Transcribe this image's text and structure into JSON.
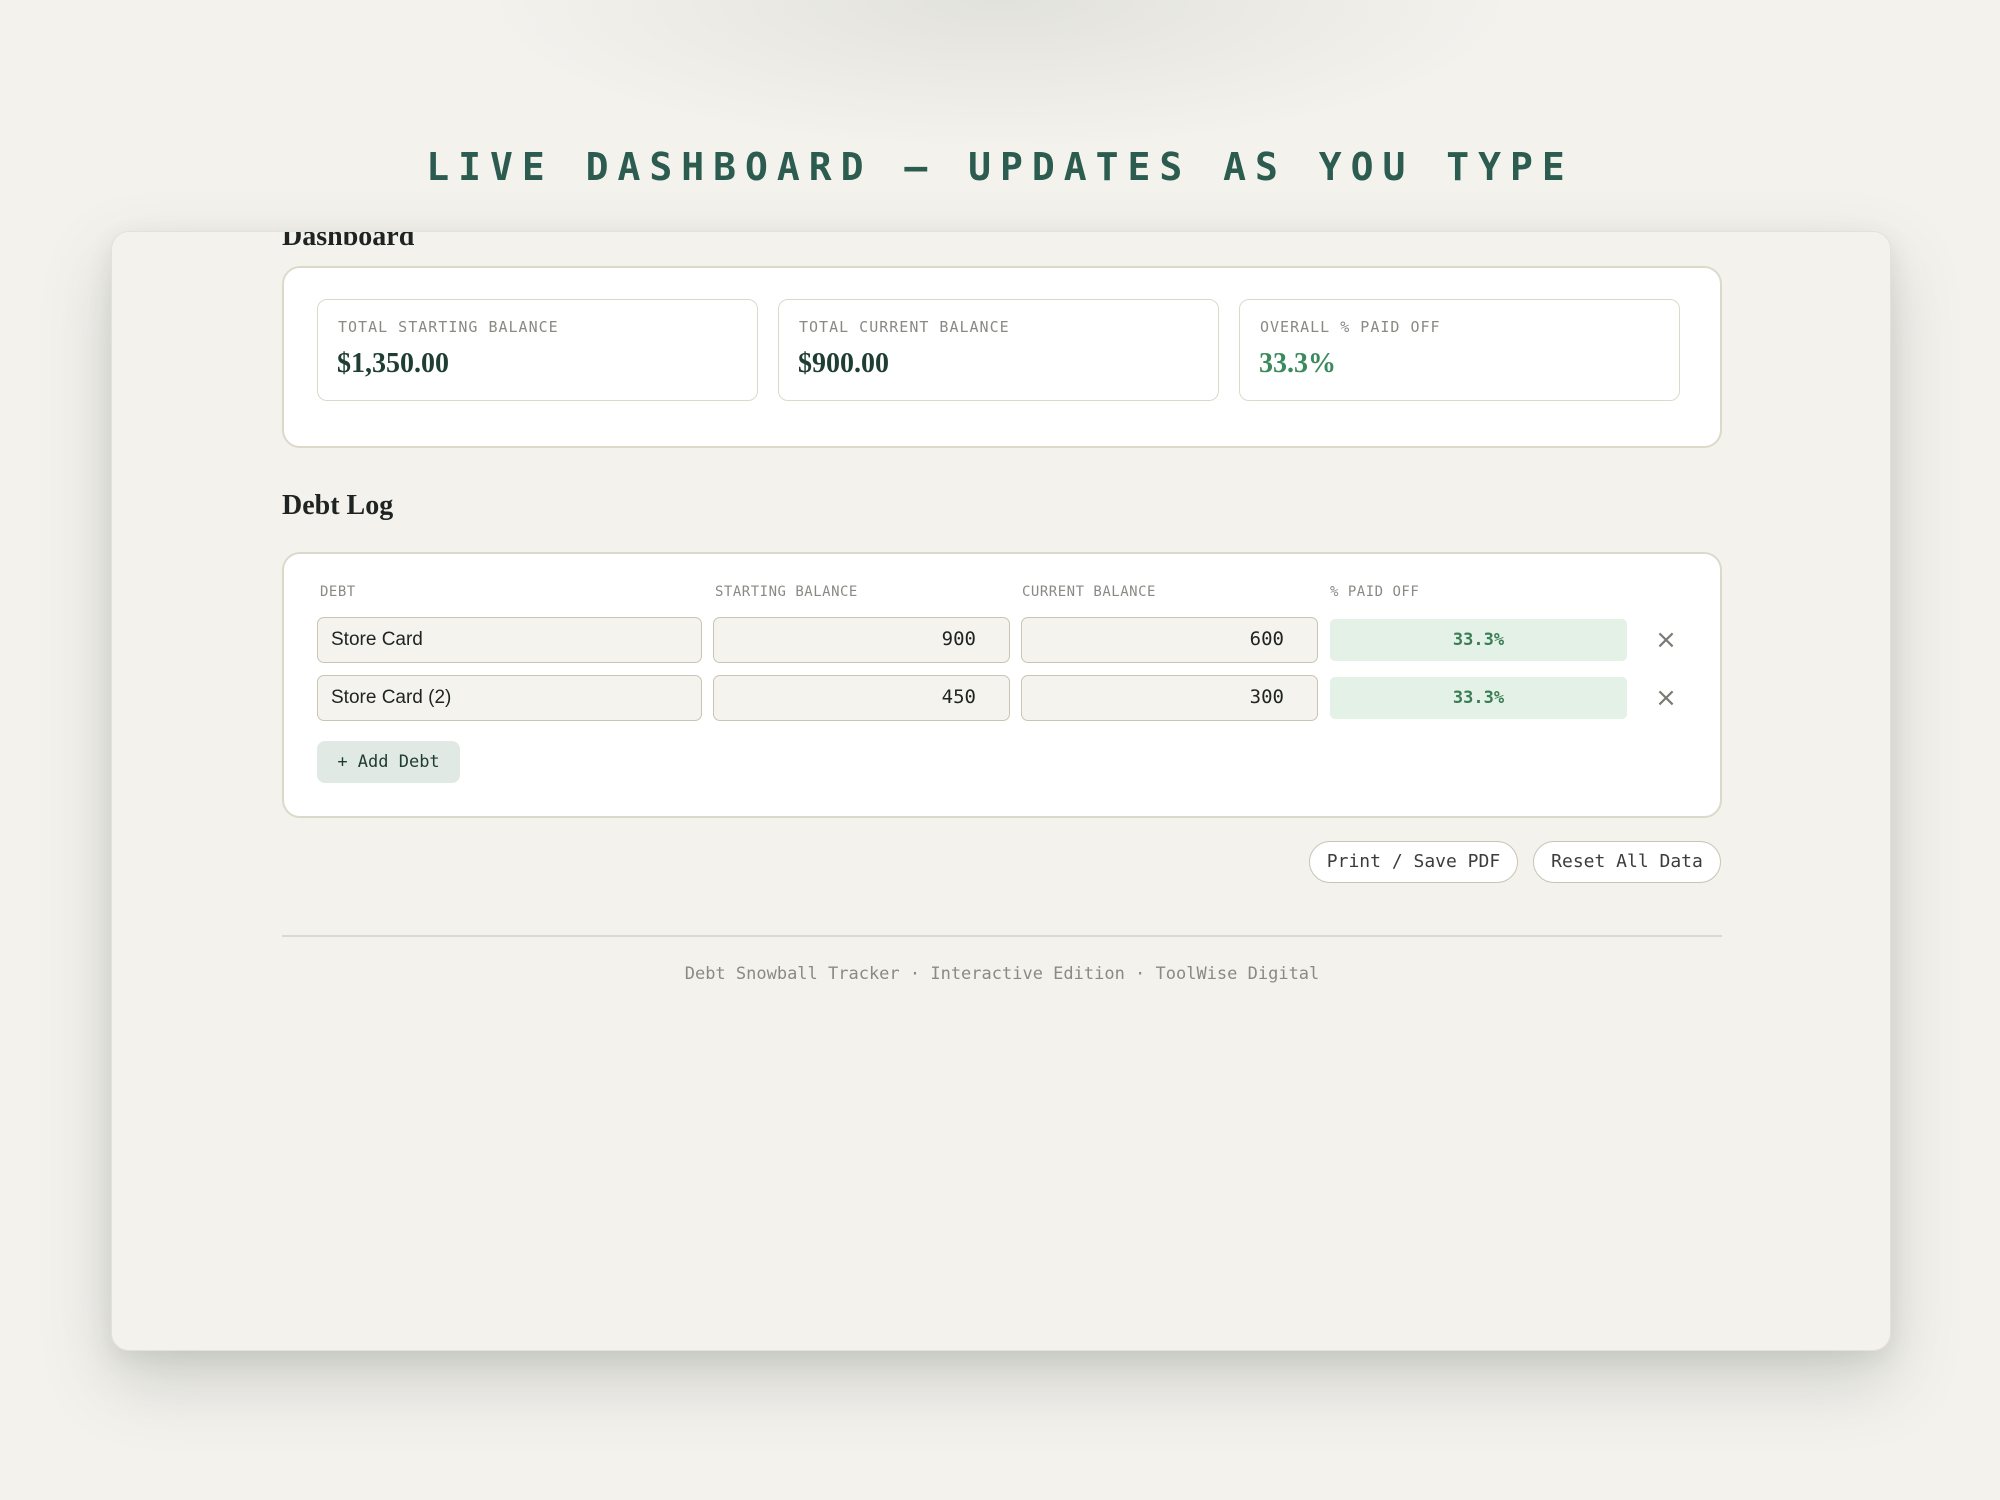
{
  "page_title": "LIVE DASHBOARD — UPDATES AS YOU TYPE",
  "dashboard": {
    "heading": "Dashboard",
    "stats": [
      {
        "label": "TOTAL STARTING BALANCE",
        "value": "$1,350.00"
      },
      {
        "label": "TOTAL CURRENT BALANCE",
        "value": "$900.00"
      },
      {
        "label": "OVERALL % PAID OFF",
        "value": "33.3%"
      }
    ]
  },
  "debt_log": {
    "heading": "Debt Log",
    "columns": [
      "DEBT",
      "STARTING BALANCE",
      "CURRENT BALANCE",
      "% PAID OFF"
    ],
    "rows": [
      {
        "name": "Store Card",
        "starting_balance": "900",
        "current_balance": "600",
        "paid_off": "33.3%"
      },
      {
        "name": "Store Card (2)",
        "starting_balance": "450",
        "current_balance": "300",
        "paid_off": "33.3%"
      }
    ],
    "remove_icon": "×",
    "add_label": "+ Add Debt"
  },
  "actions": {
    "print_label": "Print / Save PDF",
    "reset_label": "Reset All Data"
  },
  "footer": "Debt Snowball Tracker · Interactive Edition · ToolWise Digital",
  "colors": {
    "background": "#f4f2ed",
    "title": "#2c5c50",
    "accent_green": "#3a8a5e",
    "paid_badge": "#e3f1e6",
    "card_border": "#ddd9ca"
  }
}
